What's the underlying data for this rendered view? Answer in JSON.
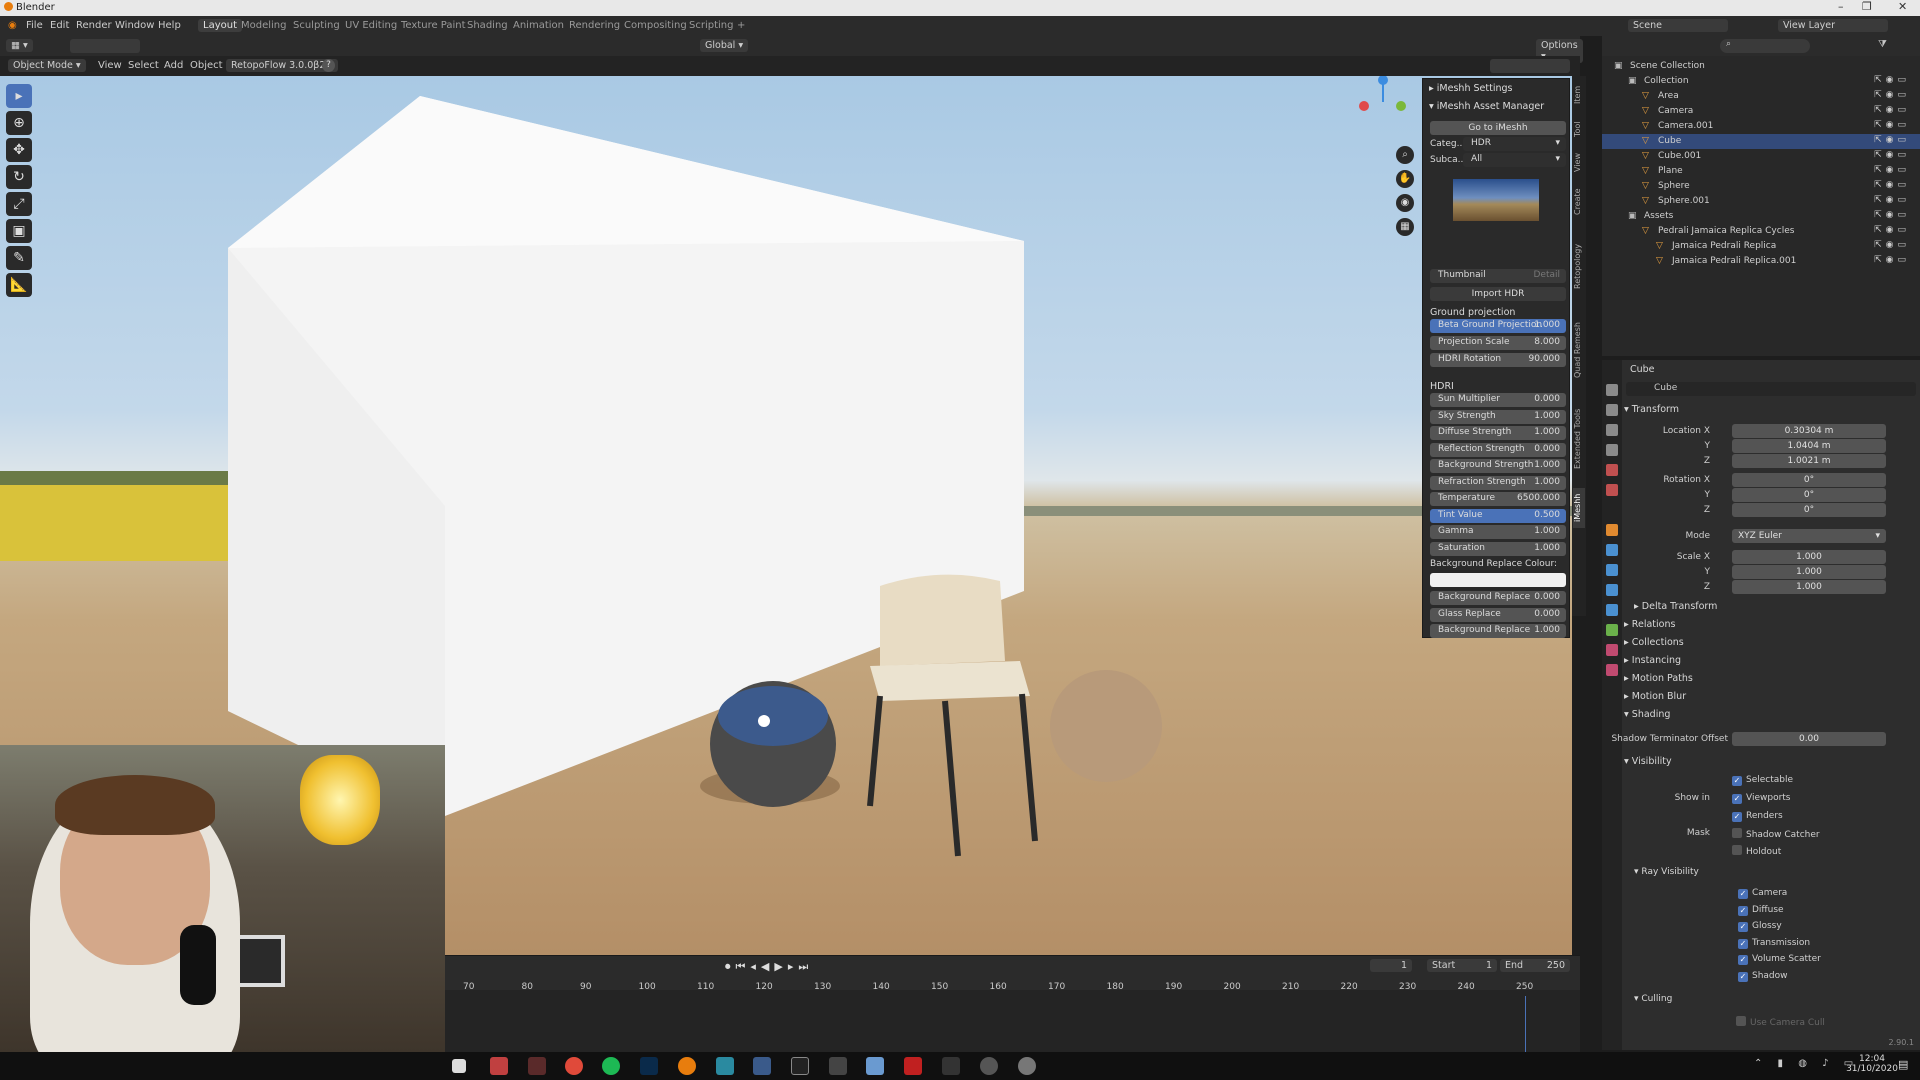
{
  "window": {
    "title": "Blender",
    "controls": [
      "–",
      "❐",
      "✕"
    ]
  },
  "menus": [
    "File",
    "Edit",
    "Render",
    "Window",
    "Help"
  ],
  "workspaces": [
    "Layout",
    "Modeling",
    "Sculpting",
    "UV Editing",
    "Texture Paint",
    "Shading",
    "Animation",
    "Rendering",
    "Compositing",
    "Scripting",
    "+"
  ],
  "active_workspace": "Layout",
  "top_right": {
    "scene": "Scene",
    "view_layer": "View Layer"
  },
  "header": {
    "transform": "Global",
    "options": "Options"
  },
  "viewport_header": {
    "mode": "Object Mode",
    "view": "View",
    "select": "Select",
    "add": "Add",
    "object": "Object",
    "addon": "RetopoFlow 3.0.0β2",
    "help": "?"
  },
  "imesh": {
    "settings": "iMeshh Settings",
    "asset_manager": "iMeshh Asset Manager",
    "goto": "Go to iMeshh",
    "category_label": "Categ...",
    "category_value": "HDR",
    "subcategory_label": "Subca...",
    "subcategory_value": "All",
    "thumbnail_tab": "Thumbnail",
    "detail_tab": "Detail",
    "import_btn": "Import HDR",
    "ground_header": "Ground projection",
    "ground": [
      {
        "label": "Beta Ground Projection",
        "value": "1.000",
        "blue": true
      },
      {
        "label": "Projection Scale",
        "value": "8.000"
      },
      {
        "label": "HDRI Rotation",
        "value": "90.000"
      }
    ],
    "hdri_header": "HDRI",
    "hdri": [
      {
        "label": "Sun Multiplier",
        "value": "0.000"
      },
      {
        "label": "Sky Strength",
        "value": "1.000"
      },
      {
        "label": "Diffuse Strength",
        "value": "1.000"
      },
      {
        "label": "Reflection Strength",
        "value": "0.000"
      },
      {
        "label": "Background Strength",
        "value": "1.000"
      },
      {
        "label": "Refraction Strength",
        "value": "1.000"
      },
      {
        "label": "Temperature",
        "value": "6500.000"
      },
      {
        "label": "Tint Value",
        "value": "0.500",
        "blue": true
      },
      {
        "label": "Gamma",
        "value": "1.000"
      },
      {
        "label": "Saturation",
        "value": "1.000"
      }
    ],
    "bg_colour_label": "Background Replace Colour:",
    "extra": [
      {
        "label": "Background Replace",
        "value": "0.000"
      },
      {
        "label": "Glass Replace",
        "value": "0.000"
      },
      {
        "label": "Background Replace",
        "value": "1.000"
      }
    ]
  },
  "side_tabs": [
    "Item",
    "Tool",
    "View",
    "Create",
    "Retopology",
    "Quad Remesh",
    "Extended Tools",
    "iMeshh"
  ],
  "timeline": {
    "ticks": [
      "70",
      "80",
      "90",
      "100",
      "110",
      "120",
      "130",
      "140",
      "150",
      "160",
      "170",
      "180",
      "190",
      "200",
      "210",
      "220",
      "230",
      "240",
      "250"
    ],
    "current": "1",
    "start_label": "Start",
    "start": "1",
    "end_label": "End",
    "end": "250"
  },
  "outliner": {
    "rows": [
      {
        "label": "Scene Collection",
        "indent": 0
      },
      {
        "label": "Collection",
        "indent": 1
      },
      {
        "label": "Area",
        "indent": 2
      },
      {
        "label": "Camera",
        "indent": 2
      },
      {
        "label": "Camera.001",
        "indent": 2
      },
      {
        "label": "Cube",
        "indent": 2,
        "selected": true
      },
      {
        "label": "Cube.001",
        "indent": 2
      },
      {
        "label": "Plane",
        "indent": 2
      },
      {
        "label": "Sphere",
        "indent": 2
      },
      {
        "label": "Sphere.001",
        "indent": 2
      },
      {
        "label": "Assets",
        "indent": 1
      },
      {
        "label": "Pedrali Jamaica Replica Cycles",
        "indent": 2
      },
      {
        "label": "Jamaica Pedrali Replica",
        "indent": 3
      },
      {
        "label": "Jamaica Pedrali Replica.001",
        "indent": 3
      }
    ]
  },
  "properties": {
    "object_name": "Cube",
    "data_name": "Cube",
    "transform_header": "Transform",
    "location": [
      {
        "label": "Location X",
        "value": "0.30304 m"
      },
      {
        "label": "Y",
        "value": "1.0404 m"
      },
      {
        "label": "Z",
        "value": "1.0021 m"
      }
    ],
    "rotation": [
      {
        "label": "Rotation X",
        "value": "0°"
      },
      {
        "label": "Y",
        "value": "0°"
      },
      {
        "label": "Z",
        "value": "0°"
      }
    ],
    "mode_label": "Mode",
    "mode_value": "XYZ Euler",
    "scale": [
      {
        "label": "Scale X",
        "value": "1.000"
      },
      {
        "label": "Y",
        "value": "1.000"
      },
      {
        "label": "Z",
        "value": "1.000"
      }
    ],
    "panels": [
      "Delta Transform",
      "Relations",
      "Collections",
      "Instancing",
      "Motion Paths",
      "Motion Blur",
      "Shading"
    ],
    "shadow_label": "Shadow Terminator Offset",
    "shadow_value": "0.00",
    "visibility": "Visibility",
    "selectable": "Selectable",
    "show_in": "Show in",
    "viewports": "Viewports",
    "renders": "Renders",
    "mask": "Mask",
    "shadow_catcher": "Shadow Catcher",
    "holdout": "Holdout",
    "ray_visibility": "Ray Visibility",
    "rays": [
      "Camera",
      "Diffuse",
      "Glossy",
      "Transmission",
      "Volume Scatter",
      "Shadow"
    ],
    "culling": "Culling",
    "use_camera_cull": "Use Camera Cull",
    "version": "2.90.1"
  },
  "taskbar": {
    "time": "12:04",
    "date": "31/10/2020"
  }
}
